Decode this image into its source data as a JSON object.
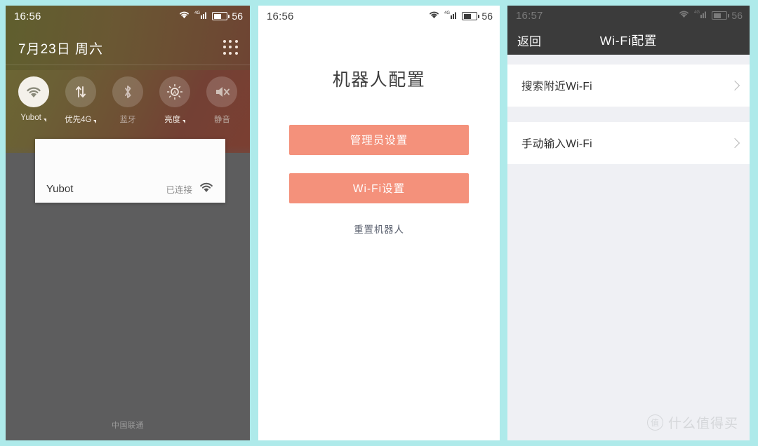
{
  "panel1": {
    "statusbar": {
      "time": "16:56",
      "battery": "56",
      "wifi_icon": "wifi-icon",
      "signal_icon": "signal-4g-icon",
      "battery_icon": "battery-icon"
    },
    "date": "7月23日  周六",
    "apps_grid_icon": "apps-grid-icon",
    "toggles": [
      {
        "label": "Yubot",
        "icon": "wifi-icon",
        "state": "on",
        "caret": true
      },
      {
        "label": "优先4G",
        "icon": "data-transfer-icon",
        "state": "off",
        "caret": true
      },
      {
        "label": "蓝牙",
        "icon": "bluetooth-icon",
        "state": "dim",
        "caret": false
      },
      {
        "label": "亮度",
        "icon": "brightness-auto-icon",
        "state": "off",
        "caret": true
      },
      {
        "label": "静音",
        "icon": "mute-icon",
        "state": "dim",
        "caret": false
      }
    ],
    "wifi_card": {
      "ssid": "Yubot",
      "status": "已连接",
      "icon": "wifi-icon"
    },
    "carrier": "中国联通"
  },
  "panel2": {
    "statusbar": {
      "time": "16:56",
      "battery": "56"
    },
    "title": "机器人配置",
    "buttons": [
      {
        "label": "管理员设置"
      },
      {
        "label": "Wi-Fi设置"
      }
    ],
    "reset_link": "重置机器人"
  },
  "panel3": {
    "statusbar": {
      "time": "16:57",
      "battery": "56"
    },
    "nav": {
      "back": "返回",
      "title": "Wi-Fi配置"
    },
    "rows": [
      {
        "label": "搜索附近Wi-Fi",
        "chevron": "chevron-right-icon"
      },
      {
        "label": "手动输入Wi-Fi",
        "chevron": "chevron-right-icon"
      }
    ]
  },
  "watermark": {
    "badge": "值",
    "text": "什么值得买"
  },
  "colors": {
    "accent": "#f4917b",
    "navbar": "#3b3b3b",
    "page_bg": "#aeeaea",
    "list_bg": "#eff0f4"
  }
}
